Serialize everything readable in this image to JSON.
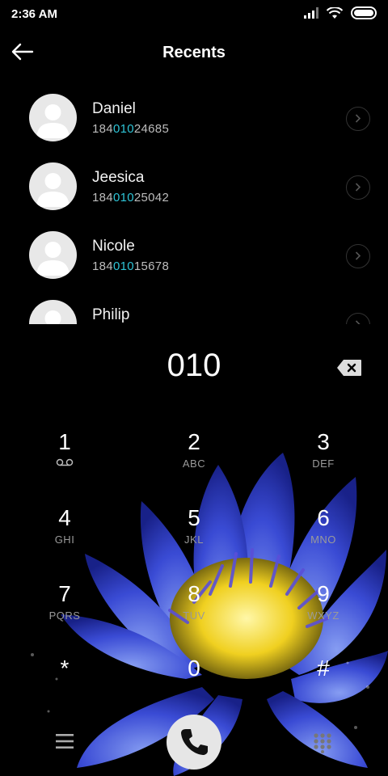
{
  "status": {
    "time": "2:36 AM"
  },
  "header": {
    "title": "Recents"
  },
  "recents": [
    {
      "name": "Daniel",
      "number_prefix": "184",
      "number_match": "010",
      "number_suffix": "24685"
    },
    {
      "name": "Jeesica",
      "number_prefix": "184",
      "number_match": "010",
      "number_suffix": "25042"
    },
    {
      "name": "Nicole",
      "number_prefix": "184",
      "number_match": "010",
      "number_suffix": "15678"
    },
    {
      "name": "Philip",
      "number_prefix": "",
      "number_match": "",
      "number_suffix": ""
    }
  ],
  "dialed": "010",
  "keypad": [
    {
      "digit": "1",
      "letters": ""
    },
    {
      "digit": "2",
      "letters": "ABC"
    },
    {
      "digit": "3",
      "letters": "DEF"
    },
    {
      "digit": "4",
      "letters": "GHI"
    },
    {
      "digit": "5",
      "letters": "JKL"
    },
    {
      "digit": "6",
      "letters": "MNO"
    },
    {
      "digit": "7",
      "letters": "PQRS"
    },
    {
      "digit": "8",
      "letters": "TUV"
    },
    {
      "digit": "9",
      "letters": "WXYZ"
    },
    {
      "digit": "*",
      "letters": ""
    },
    {
      "digit": "0",
      "letters": ""
    },
    {
      "digit": "#",
      "letters": ""
    }
  ],
  "icons": {
    "back": "arrow-left-icon",
    "row_action": "chevron-right-icon",
    "backspace": "backspace-icon",
    "voicemail": "voicemail-icon",
    "menu": "menu-icon",
    "call": "phone-icon",
    "dialpad": "dialpad-icon"
  },
  "colors": {
    "match_highlight": "#2ec4d6",
    "background": "#000000",
    "call_button": "#e6e6e6"
  }
}
